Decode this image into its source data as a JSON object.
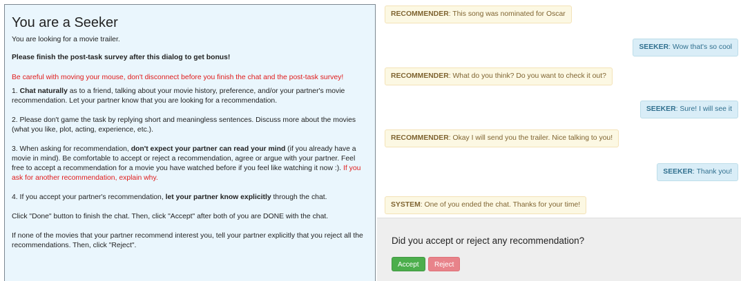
{
  "instructions": {
    "title": "You are a Seeker",
    "subtitle": "You are looking for a movie trailer.",
    "bonus": "Please finish the post-task survey after this dialog to get bonus!",
    "warning": "Be careful with moving your mouse, don't disconnect before you finish the chat and the post-task survey!",
    "item1": {
      "prefix": "1. ",
      "bold": "Chat naturally",
      "rest": " as to a friend, talking about your movie history, preference, and/or your partner's movie recommendation. Let your partner know that you are looking for a recommendation."
    },
    "item2": "2. Please don't game the task by replying short and meaningless sentences. Discuss more about the movies (what you like, plot, acting, experience, etc.).",
    "item3": {
      "prefix": "3. When asking for recommendation, ",
      "bold": "don't expect your partner can read your mind",
      "rest": " (if you already have a movie in mind). Be comfortable to accept or reject a recommendation, agree or argue with your partner. Feel free to accept a recommendation for a movie you have watched before if you feel like watching it now :). ",
      "red": "If you ask for another recommendation, explain why."
    },
    "item4": {
      "prefix": "4. If you accept your partner's recommendation, ",
      "bold": "let your partner know explicitly",
      "rest": " through the chat."
    },
    "done_note": "Click \"Done\" button to finish the chat. Then, click \"Accept\" after both of you are DONE with the chat.",
    "reject_note": "If none of the movies that your partner recommend interest you, tell your partner explicitly that you reject all the recommendations. Then, click \"Reject\"."
  },
  "chat": {
    "messages": [
      {
        "role": "RECOMMENDER",
        "text": ": This song was nominated for Oscar"
      },
      {
        "role": "SEEKER",
        "text": ": Wow that's so cool"
      },
      {
        "role": "RECOMMENDER",
        "text": ": What do you think? Do you want to check it out?"
      },
      {
        "role": "SEEKER",
        "text": ": Sure! I will see it"
      },
      {
        "role": "RECOMMENDER",
        "text": ": Okay I will send you the trailer. Nice talking to you!"
      },
      {
        "role": "SEEKER",
        "text": ": Thank you!"
      },
      {
        "role": "SYSTEM",
        "text": ": One of you ended the chat. Thanks for your time!"
      }
    ]
  },
  "survey": {
    "question": "Did you accept or reject any recommendation?",
    "accept_label": "Accept",
    "reject_label": "Reject"
  },
  "colors": {
    "panel_bg": "#eaf6fd",
    "recommender_bg": "#fcf8e3",
    "seeker_bg": "#d9edf7",
    "warning_text": "#e01b1b",
    "accept_button": "#4cae4c",
    "reject_button": "#e8838a",
    "survey_bg": "#eeeeee"
  }
}
